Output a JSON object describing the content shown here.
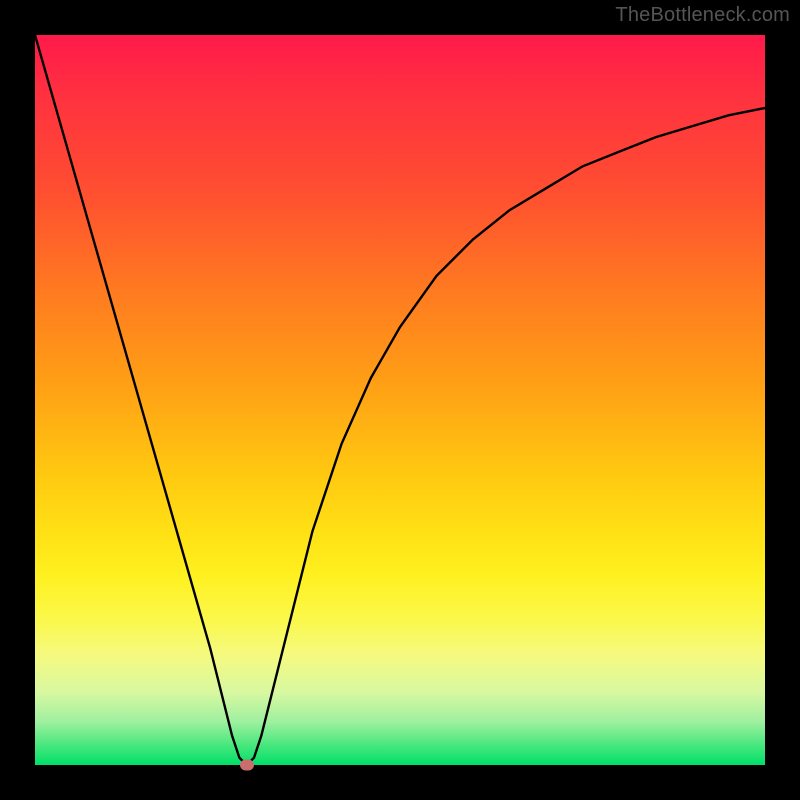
{
  "watermark": "TheBottleneck.com",
  "colors": {
    "frame_bg": "#000000",
    "curve": "#000000",
    "marker": "#c96d6d",
    "gradient_top": "#ff1a4b",
    "gradient_bottom": "#00df68"
  },
  "chart_data": {
    "type": "line",
    "title": "",
    "xlabel": "",
    "ylabel": "",
    "xlim": [
      0,
      100
    ],
    "ylim": [
      0,
      100
    ],
    "x": [
      0,
      4,
      8,
      12,
      16,
      20,
      24,
      27,
      28,
      29,
      30,
      31,
      34,
      38,
      42,
      46,
      50,
      55,
      60,
      65,
      70,
      75,
      80,
      85,
      90,
      95,
      100
    ],
    "values": [
      100,
      86,
      72,
      58,
      44,
      30,
      16,
      4,
      1,
      0,
      1,
      4,
      16,
      32,
      44,
      53,
      60,
      67,
      72,
      76,
      79,
      82,
      84,
      86,
      87.5,
      89,
      90
    ],
    "marker": {
      "x": 29,
      "y": 0
    },
    "notes": "V-shaped bottleneck curve. x,y in 0–100 normalized plot units (0,0 = bottom-left). Values estimated from pixel positions."
  }
}
